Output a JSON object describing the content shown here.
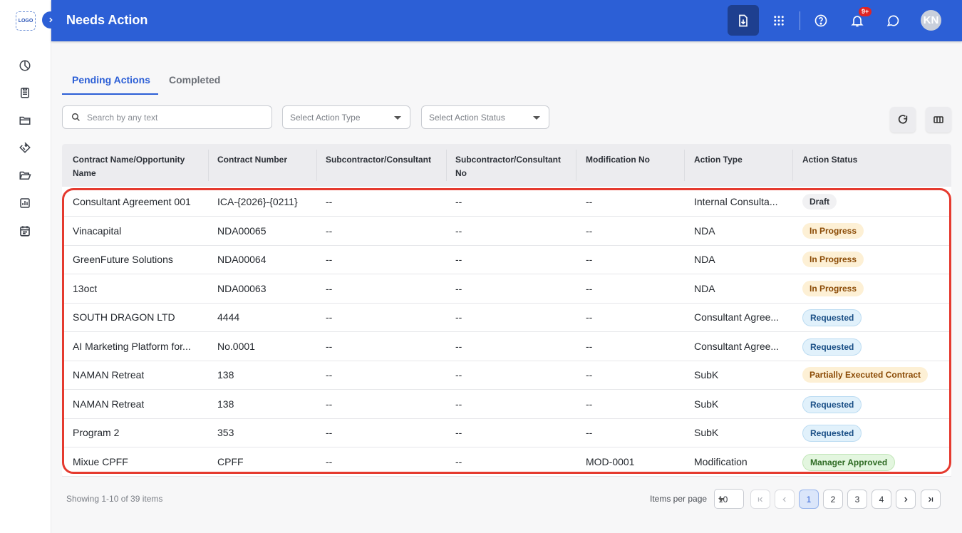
{
  "header": {
    "title": "Needs Action",
    "notification_count": "9+",
    "avatar_initials": "KN"
  },
  "logo_text": "LOGO",
  "sidebar_icons": [
    "dashboard-icon",
    "clipboard-icon",
    "folder-icon",
    "tag-icon",
    "folder-open-icon",
    "report-icon",
    "calendar-icon"
  ],
  "tabs": [
    {
      "label": "Pending Actions",
      "active": true
    },
    {
      "label": "Completed",
      "active": false
    }
  ],
  "filters": {
    "search_placeholder": "Search by any text",
    "action_type_placeholder": "Select Action Type",
    "action_status_placeholder": "Select Action Status"
  },
  "table": {
    "columns": [
      "Contract Name/Opportunity Name",
      "Contract Number",
      "Subcontractor/Consultant",
      "Subcontractor/Consultant No",
      "Modification No",
      "Action Type",
      "Action Status"
    ],
    "rows": [
      {
        "name": "Consultant Agreement 001",
        "number": "ICA-{2026}-{0211}",
        "sub": "--",
        "sub_no": "--",
        "mod": "--",
        "type": "Internal Consulta...",
        "status": "Draft",
        "status_kind": "draft"
      },
      {
        "name": "Vinacapital",
        "number": "NDA00065",
        "sub": "--",
        "sub_no": "--",
        "mod": "--",
        "type": "NDA",
        "status": "In Progress",
        "status_kind": "progress"
      },
      {
        "name": "GreenFuture Solutions",
        "number": "NDA00064",
        "sub": "--",
        "sub_no": "--",
        "mod": "--",
        "type": "NDA",
        "status": "In Progress",
        "status_kind": "progress"
      },
      {
        "name": "13oct",
        "number": "NDA00063",
        "sub": "--",
        "sub_no": "--",
        "mod": "--",
        "type": "NDA",
        "status": "In Progress",
        "status_kind": "progress"
      },
      {
        "name": "SOUTH DRAGON LTD",
        "number": "4444",
        "sub": "--",
        "sub_no": "--",
        "mod": "--",
        "type": "Consultant Agree...",
        "status": "Requested",
        "status_kind": "requested"
      },
      {
        "name": "AI Marketing Platform for...",
        "number": "No.0001",
        "sub": "--",
        "sub_no": "--",
        "mod": "--",
        "type": "Consultant Agree...",
        "status": "Requested",
        "status_kind": "requested"
      },
      {
        "name": "NAMAN Retreat",
        "number": "138",
        "sub": "--",
        "sub_no": "--",
        "mod": "--",
        "type": "SubK",
        "status": "Partially Executed Contract",
        "status_kind": "partial"
      },
      {
        "name": "NAMAN Retreat",
        "number": "138",
        "sub": "--",
        "sub_no": "--",
        "mod": "--",
        "type": "SubK",
        "status": "Requested",
        "status_kind": "requested"
      },
      {
        "name": "Program 2",
        "number": "353",
        "sub": "--",
        "sub_no": "--",
        "mod": "--",
        "type": "SubK",
        "status": "Requested",
        "status_kind": "requested"
      },
      {
        "name": "Mixue CPFF",
        "number": "CPFF",
        "sub": "--",
        "sub_no": "--",
        "mod": "MOD-0001",
        "type": "Modification",
        "status": "Manager Approved",
        "status_kind": "approved"
      }
    ]
  },
  "pagination": {
    "showing_text": "Showing 1-10 of 39 items",
    "items_per_page_label": "Items per page",
    "items_per_page": "10",
    "pages": [
      "1",
      "2",
      "3",
      "4"
    ],
    "current_page": "1"
  },
  "colors": {
    "brand": "#2c5fd6",
    "highlight": "#e53a2f"
  }
}
